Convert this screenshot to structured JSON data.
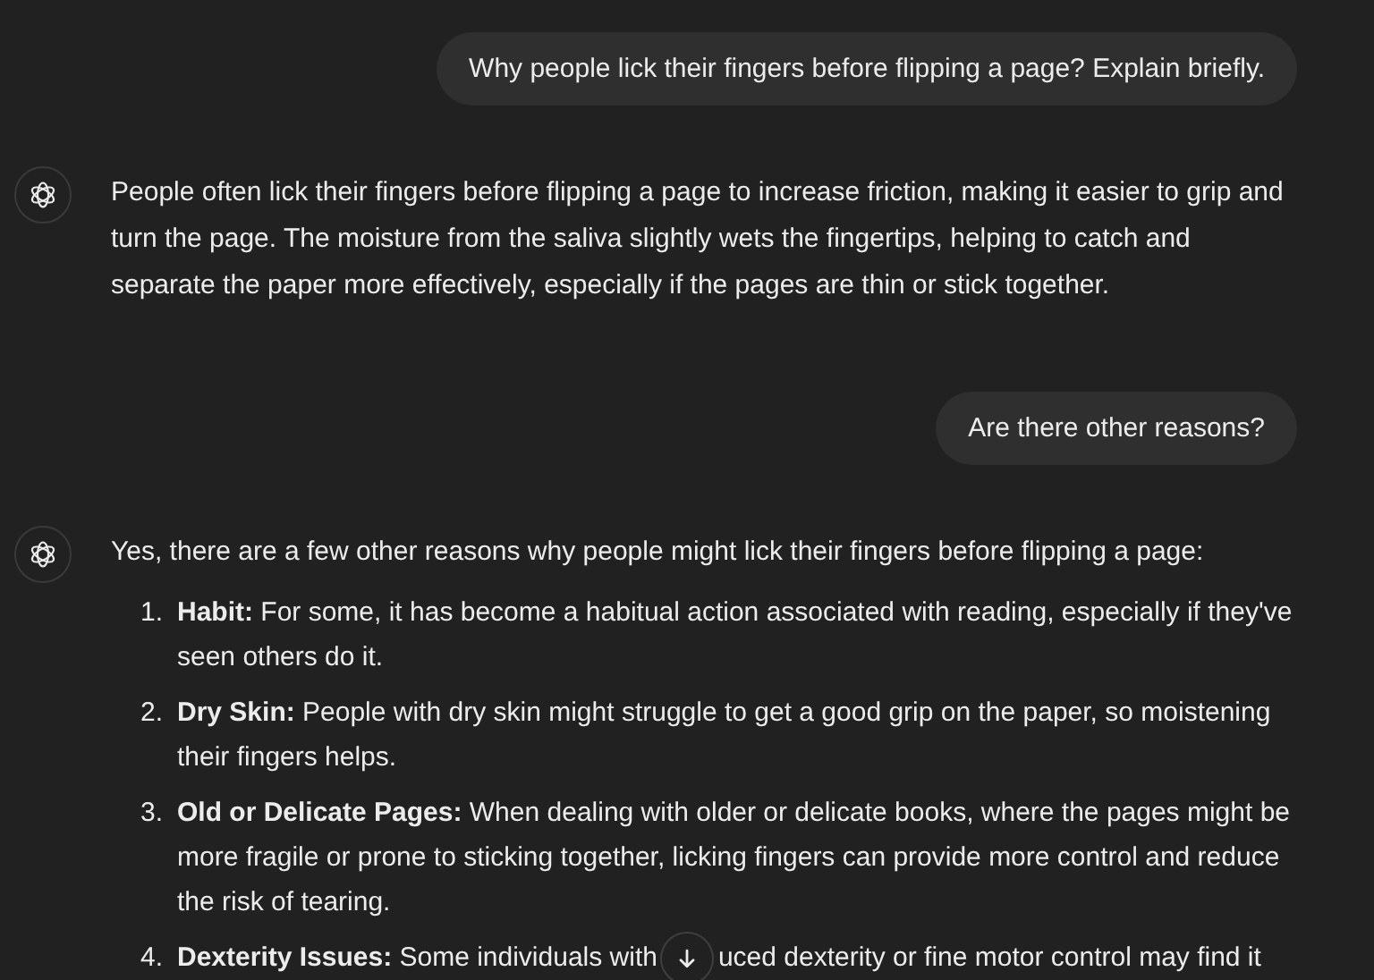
{
  "messages": [
    {
      "kind": "user",
      "text": "Why people lick their fingers before flipping a page? Explain briefly."
    },
    {
      "kind": "assistant",
      "paragraphs": [
        "People often lick their fingers before flipping a page to increase friction, making it easier to grip and turn the page. The moisture from the saliva slightly wets the fingertips, helping to catch and separate the paper more effectively, especially if the pages are thin or stick together."
      ]
    },
    {
      "kind": "user",
      "text": "Are there other reasons?"
    },
    {
      "kind": "assistant",
      "paragraphs": [
        "Yes, there are a few other reasons why people might lick their fingers before flipping a page:"
      ],
      "items": [
        {
          "number": "1.",
          "text_parts": [
            "**Habit:** For some, it has become a habitual action associated with reading, especially if they've seen others do it."
          ]
        },
        {
          "number": "2.",
          "text_parts": [
            "**Dry Skin:** People with dry skin might struggle to get a good grip on the paper, so moistening their fingers helps."
          ]
        },
        {
          "number": "3.",
          "text_parts": [
            "**Old or Delicate Pages:** When dealing with older or delicate books, where the pages might be more fragile or prone to sticking together, licking fingers can provide more control and reduce the risk of tearing."
          ]
        },
        {
          "number": "4.",
          "text_parts": [
            "**Dexterity Issues:** Some individuals with",
            "uced dexterity or fine motor control may find it"
          ]
        }
      ]
    }
  ]
}
